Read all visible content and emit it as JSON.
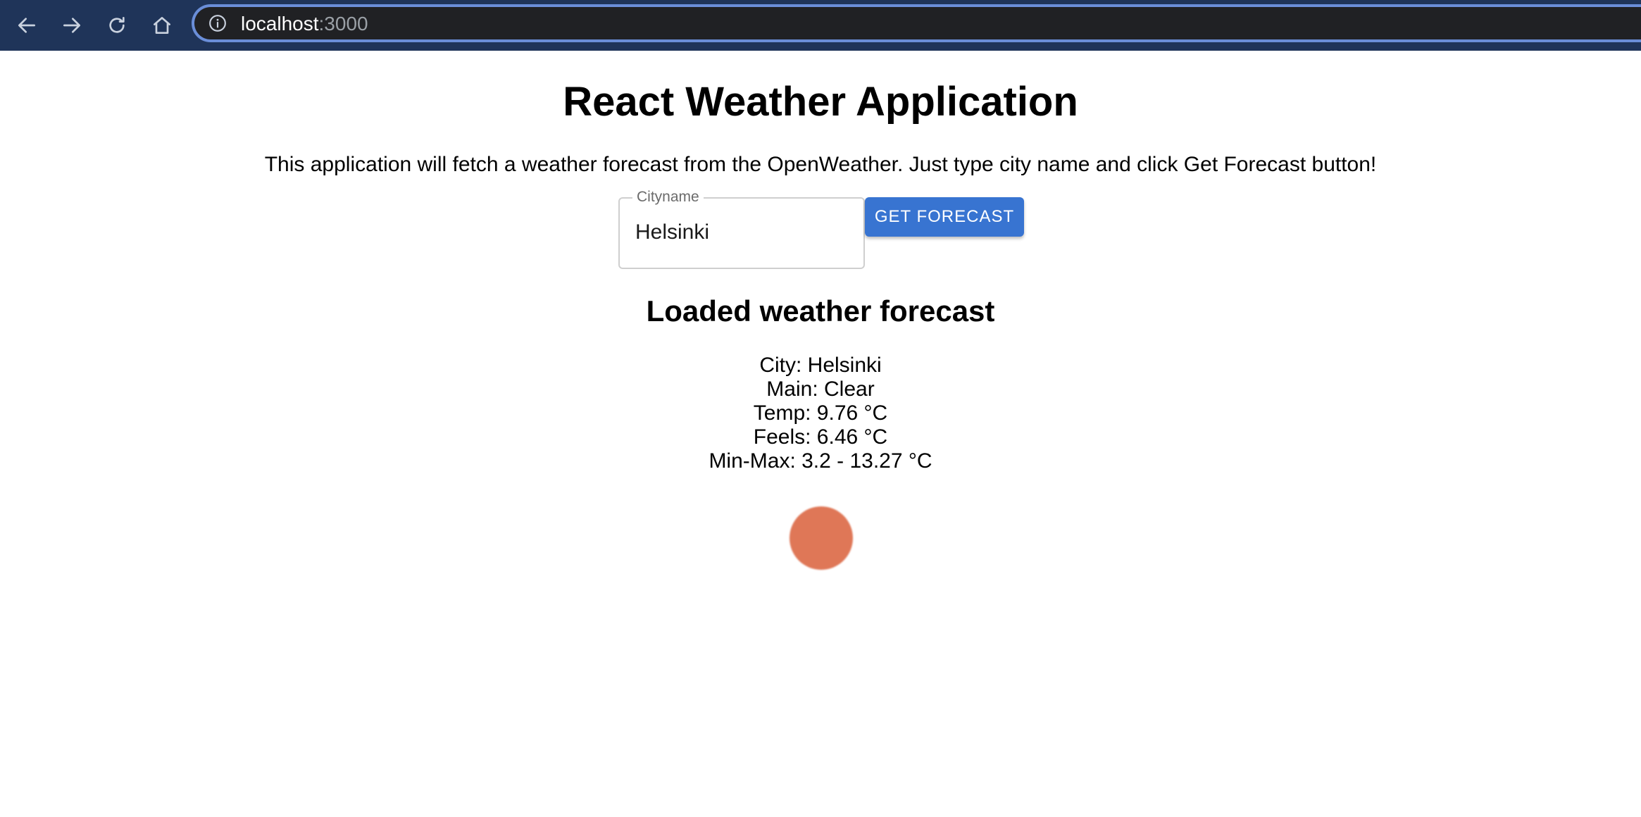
{
  "browser": {
    "url_host": "localhost",
    "url_port": ":3000"
  },
  "page": {
    "title": "React Weather Application",
    "subtitle": "This application will fetch a weather forecast from the OpenWeather. Just type city name and click Get Forecast button!",
    "cityname_label": "Cityname",
    "cityname_value": "Helsinki",
    "get_forecast_label": "GET FORECAST",
    "forecast_title": "Loaded weather forecast",
    "forecast": {
      "city": "City: Helsinki",
      "main": "Main: Clear",
      "temp": "Temp: 9.76 °C",
      "feels": "Feels: 6.46 °C",
      "minmax": "Min-Max: 3.2 - 13.27 °C"
    },
    "weather_icon": "sun-icon"
  },
  "colors": {
    "browser_bar": "#1f3459",
    "address_bar": "#202124",
    "address_focus": "#6a8ed8",
    "button": "#3874d1",
    "sun": "#df7757"
  }
}
